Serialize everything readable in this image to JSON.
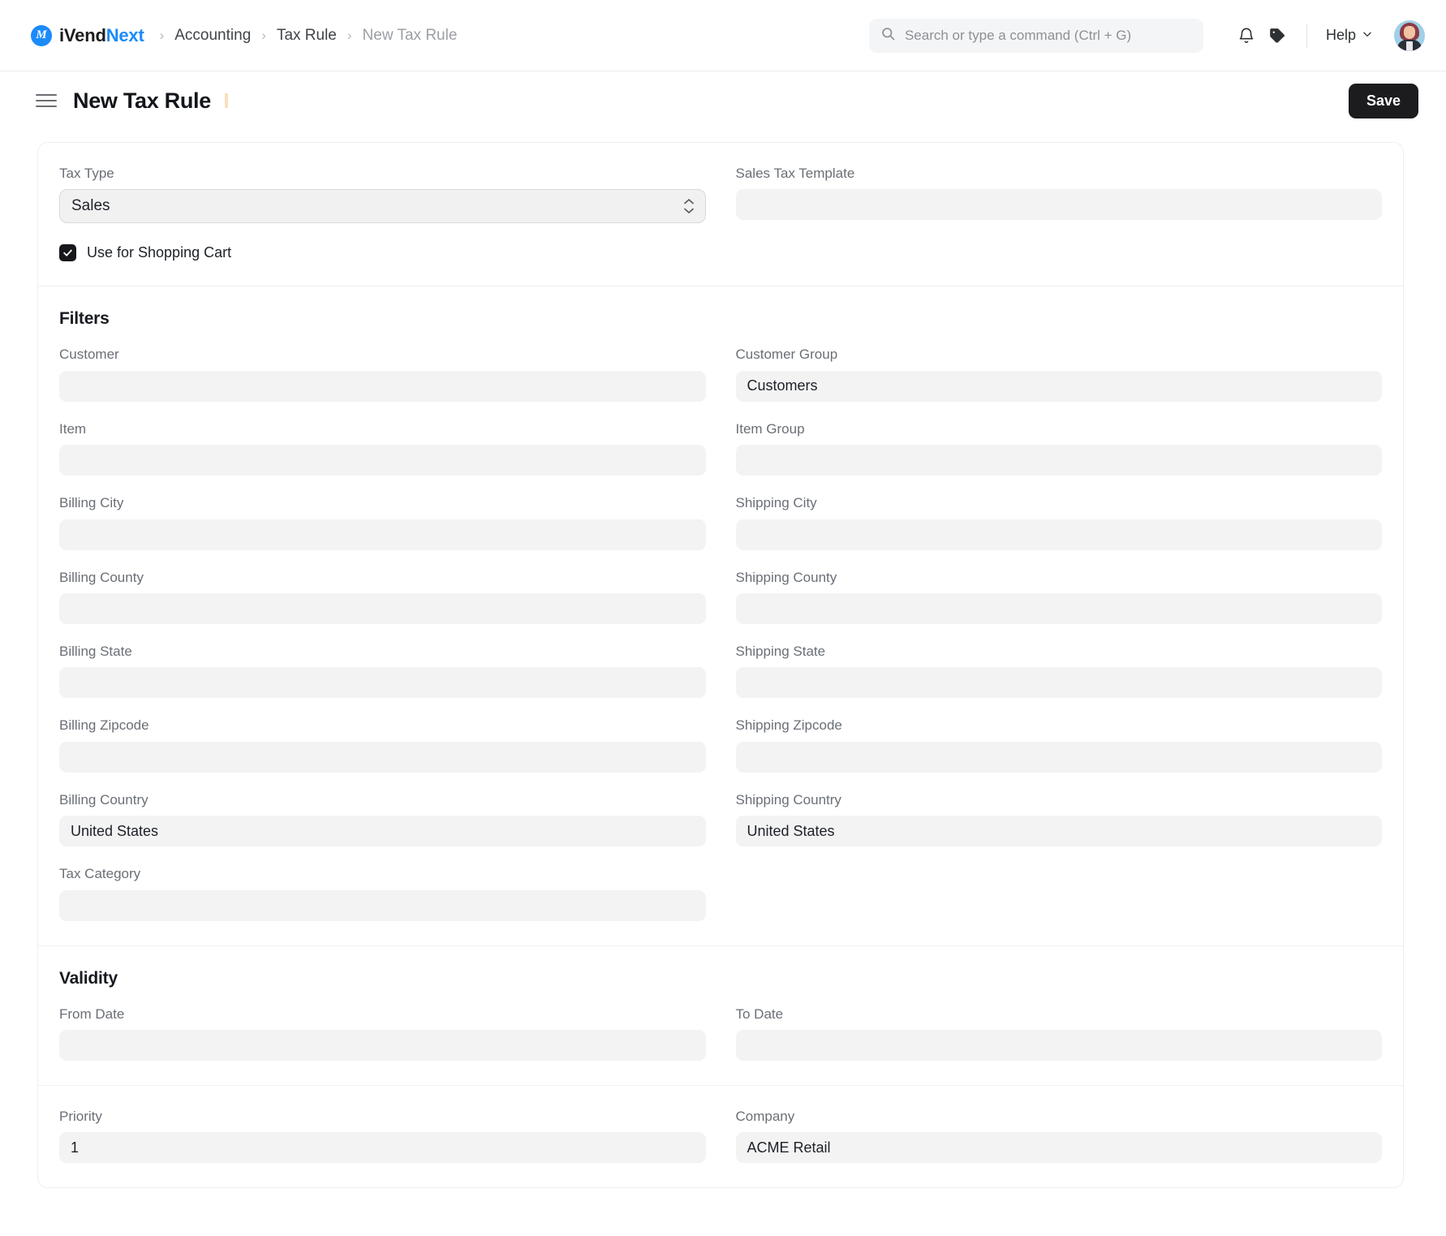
{
  "navbar": {
    "brand": {
      "part1": "iVend",
      "part2": "Next",
      "mark": "M"
    },
    "breadcrumbs": [
      {
        "label": "Accounting",
        "current": false
      },
      {
        "label": "Tax Rule",
        "current": false
      },
      {
        "label": "New Tax Rule",
        "current": true
      }
    ],
    "search": {
      "placeholder": "Search or type a command (Ctrl + G)",
      "value": ""
    },
    "icons": [
      {
        "name": "notifications-bell-icon"
      },
      {
        "name": "tag-icon"
      }
    ],
    "help_label": "Help"
  },
  "pagehead": {
    "title": "New Tax Rule",
    "save_label": "Save",
    "menu_icon": "hamburger-menu-icon"
  },
  "form": {
    "tax_type": {
      "label": "Tax Type",
      "value": "Sales"
    },
    "sales_tax_template": {
      "label": "Sales Tax Template",
      "value": ""
    },
    "use_for_shopping_cart": {
      "label": "Use for Shopping Cart",
      "checked": true
    },
    "sections": [
      {
        "title": "Filters",
        "rows": [
          [
            {
              "label": "Customer",
              "value": ""
            },
            {
              "label": "Customer Group",
              "value": "Customers"
            }
          ],
          [
            {
              "label": "Item",
              "value": ""
            },
            {
              "label": "Item Group",
              "value": ""
            }
          ],
          [
            {
              "label": "Billing City",
              "value": ""
            },
            {
              "label": "Shipping City",
              "value": ""
            }
          ],
          [
            {
              "label": "Billing County",
              "value": ""
            },
            {
              "label": "Shipping County",
              "value": ""
            }
          ],
          [
            {
              "label": "Billing State",
              "value": ""
            },
            {
              "label": "Shipping State",
              "value": ""
            }
          ],
          [
            {
              "label": "Billing Zipcode",
              "value": ""
            },
            {
              "label": "Shipping Zipcode",
              "value": ""
            }
          ],
          [
            {
              "label": "Billing Country",
              "value": "United States"
            },
            {
              "label": "Shipping Country",
              "value": "United States"
            }
          ],
          [
            {
              "label": "Tax Category",
              "value": ""
            },
            null
          ]
        ]
      },
      {
        "title": "Validity",
        "rows": [
          [
            {
              "label": "From Date",
              "value": ""
            },
            {
              "label": "To Date",
              "value": ""
            }
          ]
        ]
      },
      {
        "title": "",
        "rows": [
          [
            {
              "label": "Priority",
              "value": "1"
            },
            {
              "label": "Company",
              "value": "ACME Retail"
            }
          ]
        ]
      }
    ]
  },
  "colors": {
    "brand_blue": "#1b8bf9",
    "save_button_bg": "#1c1c1f",
    "input_bg": "#f3f3f4",
    "label_text": "#6a6f76"
  }
}
